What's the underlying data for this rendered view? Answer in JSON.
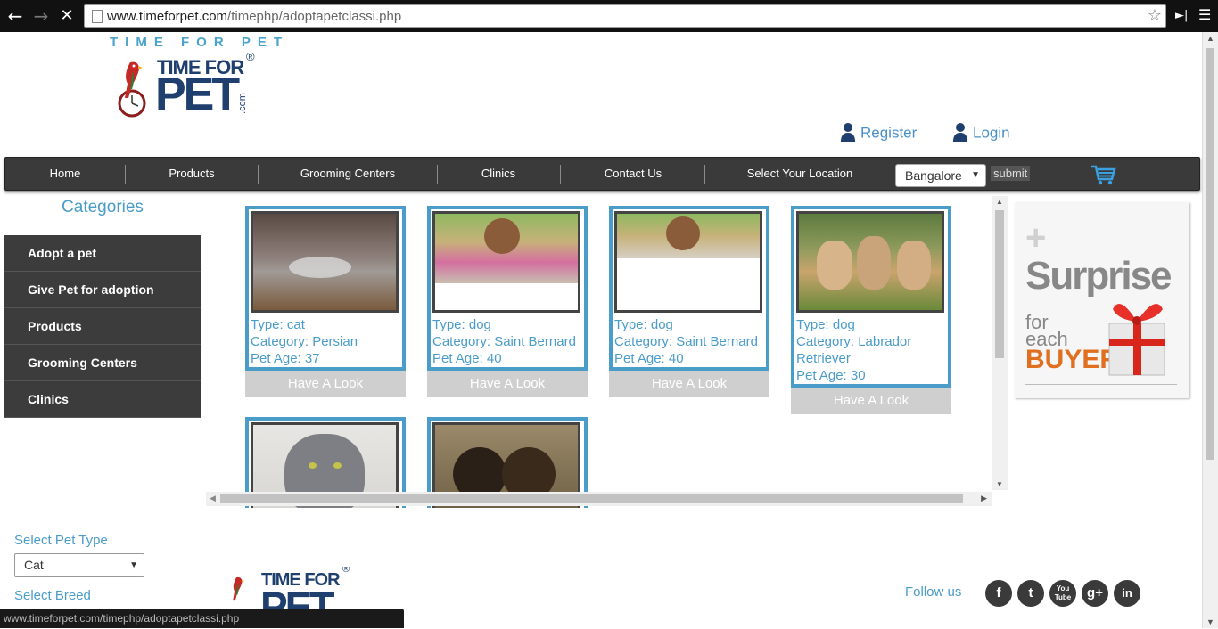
{
  "browser": {
    "url_host": "www.timeforpet.com",
    "url_path": "/timephp/adoptapetclassi.php",
    "status_url": "www.timeforpet.com/timephp/adoptapetclassi.php"
  },
  "header": {
    "brand_top": "TIME FOR PET",
    "logo_line1": "TIME FOR",
    "logo_line2": "PET",
    "logo_reg": "®",
    "logo_com": ".com",
    "register": "Register",
    "login": "Login"
  },
  "nav": {
    "items": [
      "Home",
      "Products",
      "Grooming Centers",
      "Clinics",
      "Contact Us",
      "Select Your Location"
    ],
    "location": "Bangalore",
    "submit": "submit"
  },
  "categories": {
    "title": "Categories",
    "items": [
      "Adopt a pet",
      "Give Pet for adoption",
      "Products",
      "Grooming Centers",
      "Clinics"
    ]
  },
  "pets": [
    {
      "type": "Type: cat",
      "category": "Category: Persian",
      "age": "Pet Age: 37",
      "button": "Have A Look"
    },
    {
      "type": "Type: dog",
      "category": "Category: Saint Bernard",
      "age": "Pet Age: 40",
      "button": "Have A Look"
    },
    {
      "type": "Type: dog",
      "category": "Category: Saint Bernard",
      "age": "Pet Age: 40",
      "button": "Have A Look"
    },
    {
      "type": "Type: dog",
      "category": "Category: Labrador Retriever",
      "age": "Pet Age: 30",
      "button": "Have A Look"
    }
  ],
  "ad": {
    "line1": "Surprise",
    "line2": "for",
    "line3": "each",
    "line4": "BUYER"
  },
  "filters": {
    "pet_type_label": "Select Pet Type",
    "pet_type_value": "Cat",
    "breed_label": "Select Breed"
  },
  "footer": {
    "follow_us": "Follow us",
    "social": [
      "f",
      "t",
      "You Tube",
      "g+",
      "in"
    ]
  },
  "colors": {
    "accent": "#4a9cc9",
    "nav_bg": "#3a3a3a",
    "brand_dark": "#1f3f6e"
  }
}
